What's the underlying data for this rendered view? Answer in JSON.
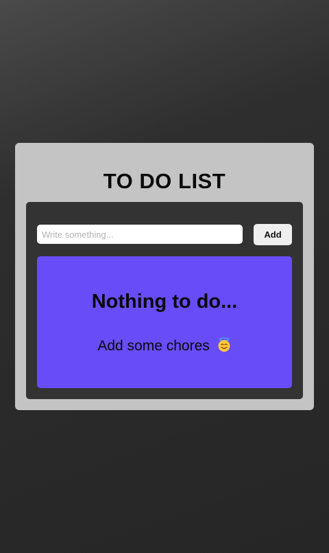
{
  "app": {
    "title": "TO DO LIST"
  },
  "input": {
    "placeholder": "Write something...",
    "value": ""
  },
  "toolbar": {
    "add_label": "Add"
  },
  "empty_state": {
    "heading": "Nothing to do...",
    "message": "Add some chores",
    "icon": "smiling-face-with-halo-icon"
  },
  "colors": {
    "background": "#2b2b2b",
    "card": "#c4c4c4",
    "inner_panel": "#333333",
    "accent": "#684cf8",
    "button": "#efefef"
  }
}
